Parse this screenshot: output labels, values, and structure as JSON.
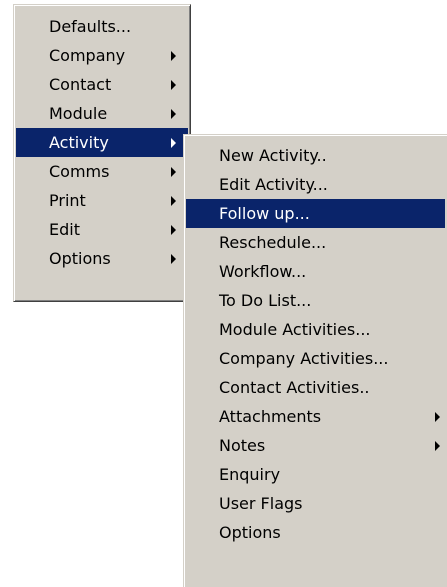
{
  "main_menu": {
    "items": [
      {
        "label": "Defaults...",
        "has_submenu": false,
        "selected": false
      },
      {
        "label": "Company",
        "has_submenu": true,
        "selected": false
      },
      {
        "label": "Contact",
        "has_submenu": true,
        "selected": false
      },
      {
        "label": "Module",
        "has_submenu": true,
        "selected": false
      },
      {
        "label": "Activity",
        "has_submenu": true,
        "selected": true
      },
      {
        "label": "Comms",
        "has_submenu": true,
        "selected": false
      },
      {
        "label": "Print",
        "has_submenu": true,
        "selected": false
      },
      {
        "label": "Edit",
        "has_submenu": true,
        "selected": false
      },
      {
        "label": "Options",
        "has_submenu": true,
        "selected": false
      }
    ]
  },
  "activity_submenu": {
    "items": [
      {
        "label": "New Activity..",
        "has_submenu": false,
        "selected": false
      },
      {
        "label": "Edit Activity...",
        "has_submenu": false,
        "selected": false
      },
      {
        "label": "Follow up...",
        "has_submenu": false,
        "selected": true
      },
      {
        "label": "Reschedule...",
        "has_submenu": false,
        "selected": false
      },
      {
        "label": "Workflow...",
        "has_submenu": false,
        "selected": false
      },
      {
        "label": "To Do List...",
        "has_submenu": false,
        "selected": false
      },
      {
        "label": "Module Activities...",
        "has_submenu": false,
        "selected": false
      },
      {
        "label": "Company Activities...",
        "has_submenu": false,
        "selected": false
      },
      {
        "label": "Contact Activities..",
        "has_submenu": false,
        "selected": false
      },
      {
        "label": "Attachments",
        "has_submenu": true,
        "selected": false
      },
      {
        "label": "Notes",
        "has_submenu": true,
        "selected": false
      },
      {
        "label": "Enquiry",
        "has_submenu": false,
        "selected": false
      },
      {
        "label": "User Flags",
        "has_submenu": false,
        "selected": false
      },
      {
        "label": "Options",
        "has_submenu": false,
        "selected": false
      }
    ]
  },
  "colors": {
    "menu_background": "#d4d0c8",
    "highlight_background": "#0a246a",
    "highlight_text": "#ffffff",
    "text": "#000000"
  }
}
